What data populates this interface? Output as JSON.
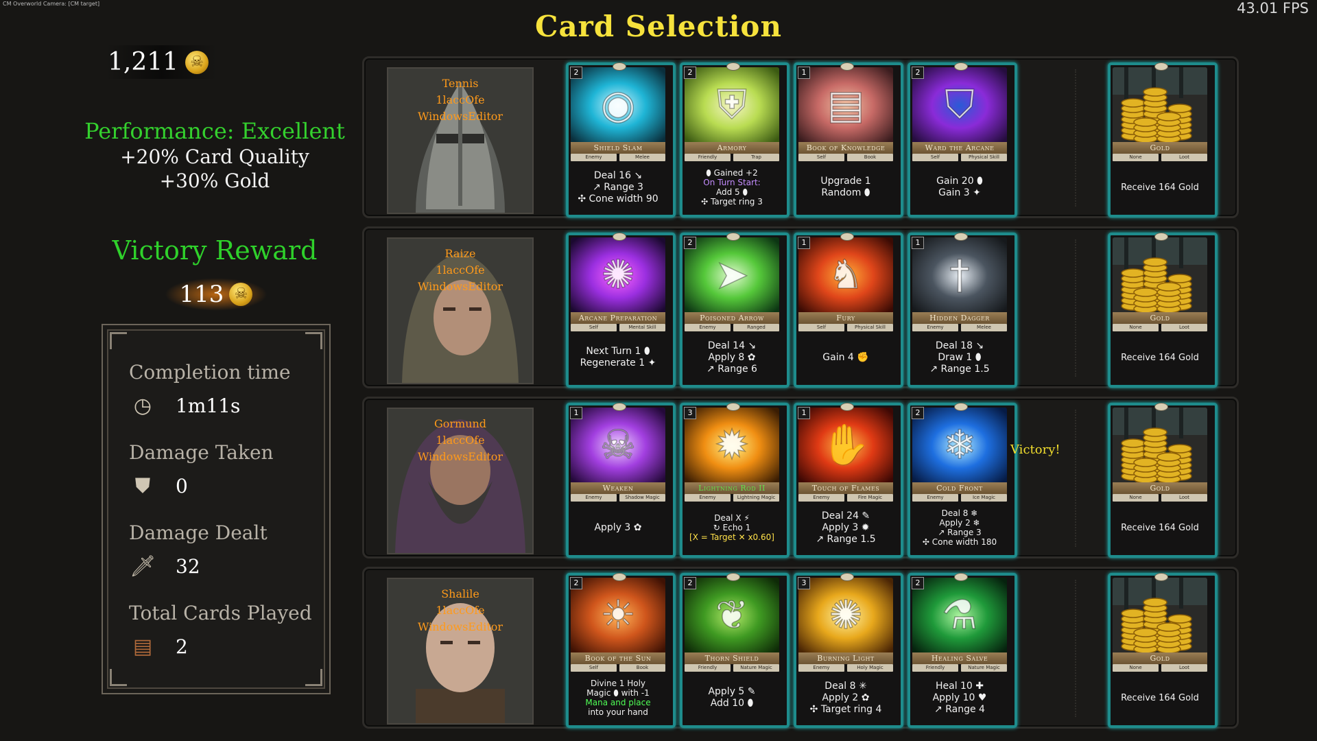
{
  "debug_label": "CM Overworld Camera: [CM target]",
  "fps": "43.01 FPS",
  "title": "Card Selection",
  "gold_total": "1,211",
  "performance": {
    "rating": "Performance: Excellent",
    "card_quality": "+20% Card Quality",
    "gold_bonus": "+30% Gold"
  },
  "victory_reward": {
    "label": "Victory Reward",
    "amount": "113"
  },
  "stats": {
    "completion_time": {
      "label": "Completion time",
      "value": "1m11s",
      "icon": "clock-icon"
    },
    "damage_taken": {
      "label": "Damage Taken",
      "value": "0",
      "icon": "armor-icon"
    },
    "damage_dealt": {
      "label": "Damage Dealt",
      "value": "32",
      "icon": "sword-icon"
    },
    "cards_played": {
      "label": "Total Cards Played",
      "value": "2",
      "icon": "card-book-icon"
    }
  },
  "victory_text": "Victory!",
  "rows": [
    {
      "hero": {
        "name": "Tennis",
        "line2": "1laccOfe",
        "line3": "WindowsEditor",
        "skin": "#7a7b76",
        "hood": "#5d5f5b",
        "kind": "helmet"
      },
      "cards": [
        {
          "cost": "2",
          "name": "Shield Slam",
          "tags": [
            "Enemy",
            "Melee"
          ],
          "lines": [
            {
              "t": "Deal 16 ↘"
            },
            {
              "t": "↗ Range 3"
            },
            {
              "t": "✣ Cone width 90"
            }
          ],
          "colors": [
            "#0a2f3c",
            "#1fb5d6",
            "#d5f6ff"
          ],
          "symbol": "◉"
        },
        {
          "cost": "2",
          "name": "Armory",
          "tags": [
            "Friendly",
            "Trap"
          ],
          "small": true,
          "lines": [
            {
              "t": "⬮ Gained +2"
            },
            {
              "t": "On Turn Start:",
              "c": "purple"
            },
            {
              "t": "Add 5 ⬮"
            },
            {
              "t": "✣ Target ring 3"
            }
          ],
          "colors": [
            "#3b5a12",
            "#b9dc52",
            "#f6f5c8"
          ],
          "symbol": "⛨"
        },
        {
          "cost": "1",
          "name": "Book of Knowledge",
          "tags": [
            "Self",
            "Book"
          ],
          "lines": [
            {
              "t": "Upgrade 1"
            },
            {
              "t": "Random ⬮"
            }
          ],
          "colors": [
            "#3a1c1e",
            "#c76a66",
            "#f1c3a4"
          ],
          "symbol": "▤"
        },
        {
          "cost": "2",
          "name": "Ward the Arcane",
          "tags": [
            "Self",
            "Physical Skill"
          ],
          "lines": [
            {
              "t": "Gain 20 ⬮"
            },
            {
              "t": "Gain 3 ✦"
            }
          ],
          "colors": [
            "#250d3e",
            "#8a2bd8",
            "#2a5bd6"
          ],
          "symbol": "⛉"
        }
      ],
      "gold": {
        "name": "Gold",
        "tags": [
          "None",
          "Loot"
        ],
        "text": "Receive 164 Gold"
      }
    },
    {
      "hero": {
        "name": "Raize",
        "line2": "1laccOfe",
        "line3": "WindowsEditor",
        "skin": "#b28f78",
        "hood": "#5e5a49",
        "kind": "hood"
      },
      "cards": [
        {
          "cost": "",
          "name": "Arcane Preparation",
          "tags": [
            "Self",
            "Mental Skill"
          ],
          "lines": [
            {
              "t": "Next Turn 1 ⬮"
            },
            {
              "t": "Regenerate 1 ✦"
            }
          ],
          "colors": [
            "#1b0930",
            "#9b2fe0",
            "#ff66ff"
          ],
          "symbol": "✺"
        },
        {
          "cost": "2",
          "name": "Poisoned Arrow",
          "tags": [
            "Enemy",
            "Ranged"
          ],
          "lines": [
            {
              "t": "Deal 14 ↘"
            },
            {
              "t": "Apply 8 ✿"
            },
            {
              "t": "↗ Range 6"
            }
          ],
          "colors": [
            "#0c3513",
            "#55c83a",
            "#e2fbd0"
          ],
          "symbol": "➤"
        },
        {
          "cost": "1",
          "name": "Fury",
          "tags": [
            "Self",
            "Physical Skill"
          ],
          "lines": [
            {
              "t": "Gain 4 ✊"
            }
          ],
          "colors": [
            "#3b0b04",
            "#e0461a",
            "#ffb13a"
          ],
          "symbol": "♞"
        },
        {
          "cost": "1",
          "name": "Hidden Dagger",
          "tags": [
            "Enemy",
            "Melee"
          ],
          "lines": [
            {
              "t": "Deal 18 ↘"
            },
            {
              "t": "Draw 1 ⬮"
            },
            {
              "t": "↗ Range 1.5"
            }
          ],
          "colors": [
            "#16191c",
            "#4b5560",
            "#e8eef4"
          ],
          "symbol": "†"
        }
      ],
      "gold": {
        "name": "Gold",
        "tags": [
          "None",
          "Loot"
        ],
        "text": "Receive 164 Gold"
      }
    },
    {
      "hero": {
        "name": "Gormund",
        "line2": "1laccOfe",
        "line3": "WindowsEditor",
        "skin": "#9a7561",
        "hood": "#4f3a52",
        "kind": "beard"
      },
      "cards": [
        {
          "cost": "1",
          "name": "Weaken",
          "tags": [
            "Enemy",
            "Shadow Magic"
          ],
          "lines": [
            {
              "t": "Apply 3 ✿"
            }
          ],
          "colors": [
            "#24093a",
            "#a23fe0",
            "#f0d8ff"
          ],
          "symbol": "☠"
        },
        {
          "cost": "3",
          "name": "Lightning Rod II",
          "tags": [
            "Enemy",
            "Lightning Magic"
          ],
          "small": true,
          "lines": [
            {
              "t": "Deal X ⚡"
            },
            {
              "t": "↻ Echo 1"
            },
            {
              "t": "[X = Target ✕ x0.60]",
              "c": "yellow"
            }
          ],
          "colors": [
            "#3a1d03",
            "#f08e12",
            "#fff48a"
          ],
          "symbol": "✹",
          "name_color": "#63e24b"
        },
        {
          "cost": "1",
          "name": "Touch of Flames",
          "tags": [
            "Enemy",
            "Fire Magic"
          ],
          "lines": [
            {
              "t": "Deal 24 ✎"
            },
            {
              "t": "Apply 3 ✹"
            },
            {
              "t": "↗ Range 1.5"
            }
          ],
          "colors": [
            "#3d0804",
            "#e03a14",
            "#ffc04a"
          ],
          "symbol": "✋"
        },
        {
          "cost": "2",
          "name": "Cold Front",
          "tags": [
            "Enemy",
            "Ice Magic"
          ],
          "small": true,
          "lines": [
            {
              "t": "Deal 8 ❄"
            },
            {
              "t": "Apply 2 ❄"
            },
            {
              "t": "↗ Range 3"
            },
            {
              "t": "✣ Cone width 180"
            }
          ],
          "colors": [
            "#061b45",
            "#1e6fe0",
            "#b8f2ff"
          ],
          "symbol": "❄"
        }
      ],
      "gold": {
        "name": "Gold",
        "tags": [
          "None",
          "Loot"
        ],
        "text": "Receive 164 Gold"
      }
    },
    {
      "hero": {
        "name": "Shalile",
        "line2": "1laccOfe",
        "line3": "WindowsEditor",
        "skin": "#c8a892",
        "hood": "#4b3b2c",
        "kind": "bald"
      },
      "cards": [
        {
          "cost": "2",
          "name": "Book of the Sun",
          "tags": [
            "Self",
            "Book"
          ],
          "small": true,
          "lines": [
            {
              "t": "Divine 1 Holy"
            },
            {
              "t": "Magic ⬮ with -1"
            },
            {
              "t": "Mana and place",
              "c": "green"
            },
            {
              "t": "into your hand"
            }
          ],
          "colors": [
            "#3f1204",
            "#d0561c",
            "#ffb55a"
          ],
          "symbol": "☀"
        },
        {
          "cost": "2",
          "name": "Thorn Shield",
          "tags": [
            "Friendly",
            "Nature Magic"
          ],
          "lines": [
            {
              "t": "Apply 5 ✎"
            },
            {
              "t": "Add 10 ⬮"
            }
          ],
          "colors": [
            "#0e2a07",
            "#3f9a22",
            "#b5ea6a"
          ],
          "symbol": "❦"
        },
        {
          "cost": "3",
          "name": "Burning Light",
          "tags": [
            "Enemy",
            "Holy Magic"
          ],
          "lines": [
            {
              "t": "Deal 8 ✳"
            },
            {
              "t": "Apply 2 ✿"
            },
            {
              "t": "✣ Target ring 4"
            }
          ],
          "colors": [
            "#4a2505",
            "#e8a81c",
            "#fff4a8"
          ],
          "symbol": "✺"
        },
        {
          "cost": "2",
          "name": "Healing Salve",
          "tags": [
            "Friendly",
            "Nature Magic"
          ],
          "lines": [
            {
              "t": "Heal 10 ✚"
            },
            {
              "t": "Apply 10 ♥"
            },
            {
              "t": "↗ Range 4"
            }
          ],
          "colors": [
            "#06220e",
            "#1f9a3a",
            "#aef5a0"
          ],
          "symbol": "⚗"
        }
      ],
      "gold": {
        "name": "Gold",
        "tags": [
          "None",
          "Loot"
        ],
        "text": "Receive 164 Gold"
      }
    }
  ]
}
